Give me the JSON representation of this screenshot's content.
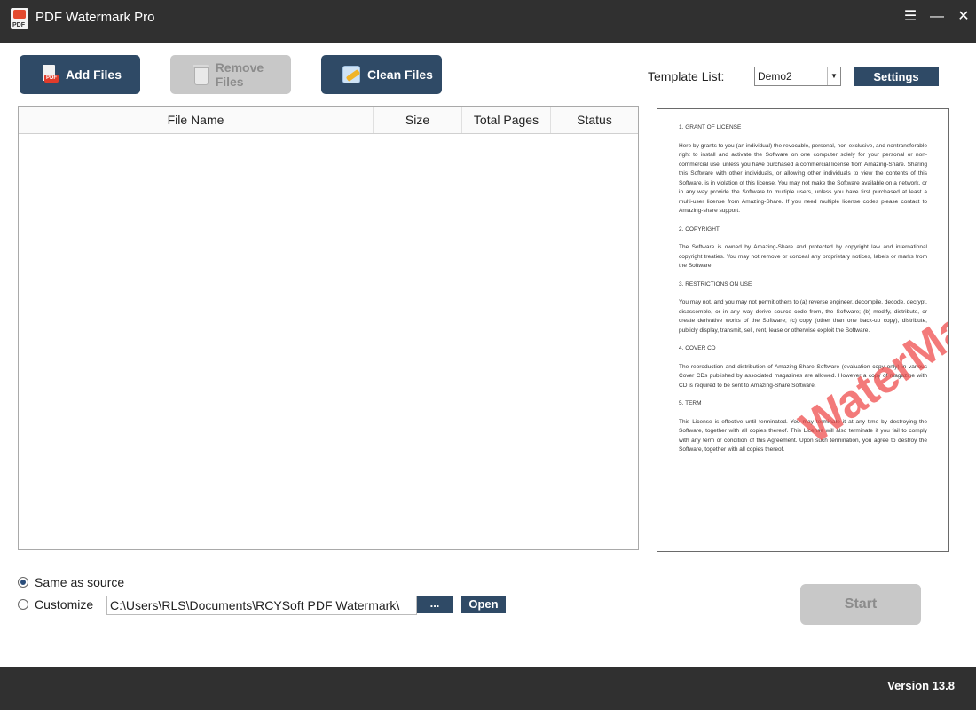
{
  "titlebar": {
    "title": "PDF Watermark Pro",
    "menu_glyph": "☰",
    "minimize_glyph": "—",
    "close_glyph": "✕"
  },
  "toolbar": {
    "add_files": "Add Files",
    "remove_files": "Remove Files",
    "clean_files": "Clean Files"
  },
  "template": {
    "label": "Template List:",
    "selected": "Demo2",
    "settings": "Settings"
  },
  "table": {
    "columns": [
      "File Name",
      "Size",
      "Total Pages",
      "Status"
    ]
  },
  "preview": {
    "watermark": "WaterMark",
    "sections": [
      {
        "heading": "1. GRANT OF LICENSE",
        "text": "Here by grants to you (an individual) the revocable, personal, non-exclusive, and nontransferable right to install and activate the Software on one computer solely for your personal or non-commercial use, unless you have purchased a commercial license from Amazing-Share. Sharing this Software with other individuals, or allowing other individuals to view the contents of this Software, is in violation of this license. You may not make the Software available on a network, or in any way provide the Software to multiple users, unless you have first purchased at least a multi-user license from Amazing-Share. If you need multiple license codes please contact to Amazing-share support."
      },
      {
        "heading": "2. COPYRIGHT",
        "text": "The Software is owned by Amazing-Share and protected by copyright law and international copyright treaties. You may not remove or conceal any proprietary notices, labels or marks from the Software."
      },
      {
        "heading": "3. RESTRICTIONS ON USE",
        "text": "You may not, and you may not permit others to (a) reverse engineer, decompile, decode, decrypt, disassemble, or in any way derive source code from, the Software; (b) modify, distribute, or create derivative works of the Software; (c) copy (other than one back-up copy), distribute, publicly display, transmit, sell, rent, lease or otherwise exploit the Software."
      },
      {
        "heading": "4. COVER CD",
        "text": "The reproduction and distribution of Amazing-Share Software (evaluation copy only) in various Cover CDs published by associated magazines are allowed. However a copy of magazine with CD is required to be sent to Amazing-Share Software."
      },
      {
        "heading": "5. TERM",
        "text": "This License is effective until terminated. You may terminate it at any time by destroying the Software, together with all copies thereof. This License will also terminate if you fail to comply with any term or condition of this Agreement. Upon such termination, you agree to destroy the Software, together with all copies thereof."
      }
    ]
  },
  "output": {
    "same_as_source": "Same as source",
    "customize": "Customize",
    "path": "C:\\Users\\RLS\\Documents\\RCYSoft PDF Watermark\\",
    "browse": "...",
    "open": "Open"
  },
  "start": "Start",
  "version": "Version 13.8"
}
